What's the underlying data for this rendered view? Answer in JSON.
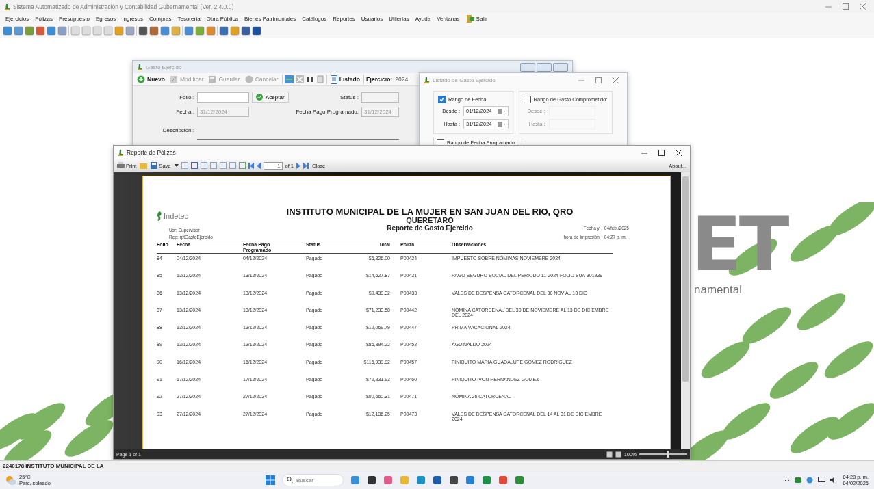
{
  "app": {
    "title": "Sistema Automatizado de Administración y Contabilidad Gubernamental  (Ver. 2.4.0.0)",
    "menu": [
      "Ejercicios",
      "Pólizas",
      "Presupuesto",
      "Egresos",
      "Ingresos",
      "Compras",
      "Tesorería",
      "Obra Pública",
      "Bienes Patrimoniales",
      "Catálogos",
      "Reportes",
      "Usuarios",
      "Utilerías",
      "Ayuda",
      "Ventanas"
    ],
    "exit": "Salir"
  },
  "wallpaper": {
    "letters": "ET",
    "word": "namental"
  },
  "gasto_window": {
    "title": "Gasto Ejercido",
    "actions": [
      {
        "label": "Nuevo",
        "disabled": false
      },
      {
        "label": "Modificar",
        "disabled": true
      },
      {
        "label": "Guardar",
        "disabled": true
      },
      {
        "label": "Cancelar",
        "disabled": true
      }
    ],
    "list_button": "Listado",
    "year_label": "Ejercicio:",
    "year_value": "2024",
    "folio_label": "Folio :",
    "accept_button": "Aceptar",
    "status_label": "Status :",
    "date": {
      "label": "Fecha :",
      "value": "31/12/2024",
      "disabled": true
    },
    "scheduled_date": {
      "label": "Fecha Pago Programado:",
      "value": "31/12/2024",
      "disabled": true
    },
    "description_label": "Descripción :"
  },
  "list_window": {
    "title": "Listado de Gasto Ejercido",
    "date_range": {
      "label": "Rango de Fecha:",
      "checked": true,
      "from_label": "Desde :",
      "from_value": "01/12/2024",
      "to_label": "Hasta :",
      "to_value": "31/12/2024"
    },
    "committed_range": {
      "label": "Rango de Gasto Comprometido:",
      "checked": false,
      "from_label": "Desde :",
      "to_label": "Hasta :"
    },
    "scheduled_range": {
      "label": "Rango de Fecha Programado:",
      "checked": false
    }
  },
  "report_window": {
    "title": "Reporte de Pólizas",
    "toolbar": {
      "print": "Print",
      "save": "Save",
      "page": "1",
      "of": "of 1",
      "close": "Close",
      "about": "About..."
    },
    "report": {
      "logo": "Indetec",
      "title": "INSTITUTO MUNICIPAL DE LA MUJER EN SAN JUAN DEL RIO, QRO",
      "subtitle": "QUERETARO",
      "name": "Reporte de Gasto Ejercido",
      "user": "Usr: Supervisor",
      "report_id": "Rep: rptGastoEjercido",
      "date_label": "Fecha y",
      "date_value": "04/feb./2025",
      "time_label": "hora de Impresión",
      "time_value": "04:27 p. m.",
      "columns": [
        "Folio",
        "Fecha",
        "Fecha Pago Programado",
        "Status",
        "Total",
        "Póliza",
        "Observaciones"
      ],
      "rows": [
        [
          "84",
          "04/12/2024",
          "04/12/2024",
          "Pagado",
          "$6,826.00",
          "P00424",
          "IMPUESTO SOBRE NÓMINAS NOVIEMBRE 2024"
        ],
        [
          "85",
          "13/12/2024",
          "13/12/2024",
          "Pagado",
          "$14,627.87",
          "P00431",
          "PAGO SEGURO SOCIAL DEL PERIODO 11-2024 FOLIO SUA 301939"
        ],
        [
          "86",
          "13/12/2024",
          "13/12/2024",
          "Pagado",
          "$9,439.32",
          "P00433",
          "VALES DE DESPENSA CATORCENAL DEL 30 NOV AL 13 DIC"
        ],
        [
          "87",
          "13/12/2024",
          "13/12/2024",
          "Pagado",
          "$71,233.58",
          "P00442",
          "NOMINA CATORCENAL DEL 30 DE NOVIEMBRE AL 13 DE DICIEMBRE DEL 2024"
        ],
        [
          "88",
          "13/12/2024",
          "13/12/2024",
          "Pagado",
          "$12,069.79",
          "P00447",
          "PRIMA VACACIONAL 2024"
        ],
        [
          "89",
          "13/12/2024",
          "13/12/2024",
          "Pagado",
          "$86,394.22",
          "P00452",
          "AGUINALDO 2024"
        ],
        [
          "90",
          "16/12/2024",
          "16/12/2024",
          "Pagado",
          "$116,939.92",
          "P00457",
          "FINIQUITO MARIA GUADALUPE GOMEZ RODRIGUEZ"
        ],
        [
          "91",
          "17/12/2024",
          "17/12/2024",
          "Pagado",
          "$72,331.93",
          "P00460",
          "FINIQUITO IVON HERNANDEZ GOMEZ"
        ],
        [
          "92",
          "27/12/2024",
          "27/12/2024",
          "Pagado",
          "$90,660.31",
          "P00471",
          "NÓMINA 26 CATORCENAL"
        ],
        [
          "93",
          "27/12/2024",
          "27/12/2024",
          "Pagado",
          "$12,136.25",
          "P00473",
          "VALES DE DESPENSA CATORCENAL DEL 14 AL 31 DE DICIEMBRE 2024"
        ]
      ]
    },
    "page_status": "Page 1 of 1",
    "zoom": {
      "label": "100%",
      "level": 0.6
    }
  },
  "status_bar": {
    "text": "2240178 INSTITUTO MUNICIPAL DE LA"
  },
  "taskbar": {
    "temperature": "25°C",
    "weather": "Parc. soleado",
    "search_placeholder": "Buscar",
    "time": "04:28 p. m.",
    "date": "04/02/2025"
  }
}
